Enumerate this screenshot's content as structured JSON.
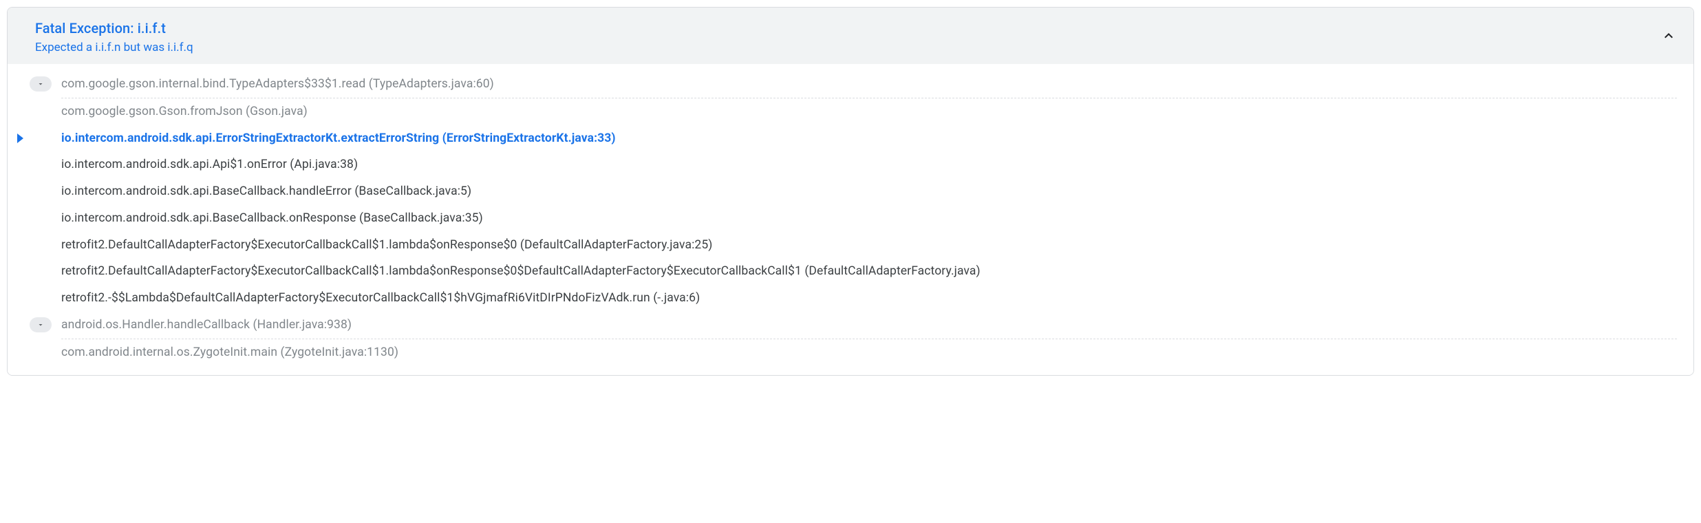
{
  "exception": {
    "title": "Fatal Exception: i.i.f.t",
    "message": "Expected a i.i.f.n but was i.i.f.q"
  },
  "frames": [
    {
      "text": "com.google.gson.internal.bind.TypeAdapters$33$1.read (TypeAdapters.java:60)",
      "style": "muted",
      "expander": true,
      "dividerAfter": true
    },
    {
      "text": "com.google.gson.Gson.fromJson (Gson.java)",
      "style": "muted"
    },
    {
      "text": "io.intercom.android.sdk.api.ErrorStringExtractorKt.extractErrorString (ErrorStringExtractorKt.java:33)",
      "style": "highlight",
      "pointer": true
    },
    {
      "text": "io.intercom.android.sdk.api.Api$1.onError (Api.java:38)",
      "style": "normal"
    },
    {
      "text": "io.intercom.android.sdk.api.BaseCallback.handleError (BaseCallback.java:5)",
      "style": "normal"
    },
    {
      "text": "io.intercom.android.sdk.api.BaseCallback.onResponse (BaseCallback.java:35)",
      "style": "normal"
    },
    {
      "text": "retrofit2.DefaultCallAdapterFactory$ExecutorCallbackCall$1.lambda$onResponse$0 (DefaultCallAdapterFactory.java:25)",
      "style": "normal"
    },
    {
      "text": "retrofit2.DefaultCallAdapterFactory$ExecutorCallbackCall$1.lambda$onResponse$0$DefaultCallAdapterFactory$ExecutorCallbackCall$1 (DefaultCallAdapterFactory.java)",
      "style": "normal"
    },
    {
      "text": "retrofit2.-$$Lambda$DefaultCallAdapterFactory$ExecutorCallbackCall$1$hVGjmafRi6VitDIrPNdoFizVAdk.run (-.java:6)",
      "style": "normal"
    },
    {
      "text": "android.os.Handler.handleCallback (Handler.java:938)",
      "style": "muted",
      "expander": true,
      "dividerAfter": true
    },
    {
      "text": "com.android.internal.os.ZygoteInit.main (ZygoteInit.java:1130)",
      "style": "muted"
    }
  ]
}
